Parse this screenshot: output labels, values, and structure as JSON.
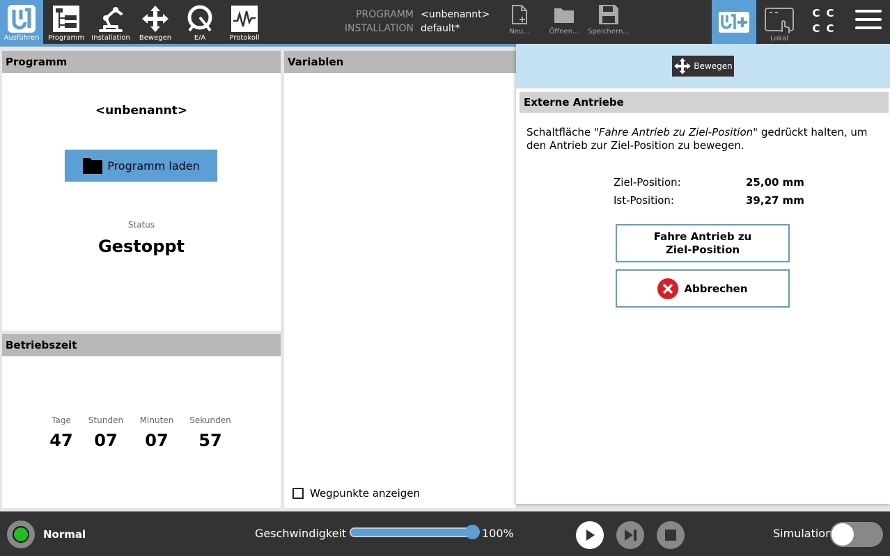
{
  "nav": {
    "items": [
      {
        "label": "Ausführen",
        "icon": "ur-logo-icon",
        "active": true
      },
      {
        "label": "Programm",
        "icon": "program-tree-icon",
        "active": false
      },
      {
        "label": "Installation",
        "icon": "robot-arm-icon",
        "active": false
      },
      {
        "label": "Bewegen",
        "icon": "move-arrows-icon",
        "active": false
      },
      {
        "label": "E/A",
        "icon": "io-icon",
        "active": false
      },
      {
        "label": "Protokoll",
        "icon": "log-waveform-icon",
        "active": false
      }
    ]
  },
  "header": {
    "program_key": "PROGRAMM",
    "program_value": "<unbenannt>",
    "installation_key": "INSTALLATION",
    "installation_value": "default*",
    "new_label": "Neu...",
    "open_label": "Öffnen...",
    "save_label": "Speichern...",
    "lokal_label": "Lokal",
    "cc": [
      "C",
      "C",
      "C",
      "C"
    ]
  },
  "program_panel": {
    "title": "Programm",
    "program_name": "<unbenannt>",
    "load_button": "Programm laden",
    "status_label": "Status",
    "status_value": "Gestoppt"
  },
  "runtime_panel": {
    "title": "Betriebszeit",
    "units": [
      {
        "label": "Tage",
        "value": "47"
      },
      {
        "label": "Stunden",
        "value": "07"
      },
      {
        "label": "Minuten",
        "value": "07"
      },
      {
        "label": "Sekunden",
        "value": "57"
      }
    ]
  },
  "variables_panel": {
    "title": "Variablen",
    "show_waypoints_label": "Wegpunkte anzeigen",
    "show_waypoints_checked": false
  },
  "overlay": {
    "move_button": "Bewegen",
    "section_title": "Externe Antriebe",
    "desc_pre": "Schaltfläche \"",
    "desc_italic": "Fahre Antrieb zu Ziel-Position",
    "desc_post": "\" gedrückt halten, um den Antrieb zur Ziel-Position zu bewegen.",
    "target_label": "Ziel-Position:",
    "target_value": "25,00 mm",
    "actual_label": "Ist-Position:",
    "actual_value": "39,27 mm",
    "drive_button_line1": "Fahre Antrieb zu",
    "drive_button_line2": "Ziel-Position",
    "cancel_button": "Abbrechen"
  },
  "footer": {
    "mode": "Normal",
    "speed_label": "Geschwindigkeit",
    "speed_percent": "100%",
    "speed_fraction": 1.0,
    "simulation_label": "Simulation",
    "simulation_on": false
  },
  "colors": {
    "accent": "#5aa0d6",
    "topbar": "#333333",
    "overlay_band": "#c4e0f3",
    "status_ok": "#1ec01e",
    "cancel_red": "#e01b24"
  }
}
